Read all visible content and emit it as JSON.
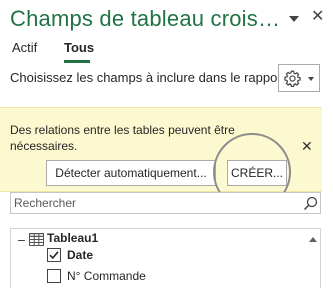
{
  "pane": {
    "title": "Champs de tableau crois…",
    "title_dropdown_icon": "chevron-down-icon",
    "close_icon": "close-icon"
  },
  "tabs": [
    {
      "label": "Actif",
      "active": false
    },
    {
      "label": "Tous",
      "active": true
    }
  ],
  "accent_color": "#217346",
  "choose_label": "Choisissez les champs à inclure dans le rapport :",
  "tools_button": {
    "icon": "gear-icon",
    "dropdown_icon": "chevron-down-icon"
  },
  "relations_notice": {
    "message": "Des relations entre les tables peuvent être nécessaires.",
    "background": "#fcf8cf",
    "detect_button": "Détecter automatiquement...",
    "create_button": "CRÉER...",
    "close_icon": "close-icon"
  },
  "search": {
    "placeholder": "Rechercher",
    "icon": "search-icon"
  },
  "field_list": {
    "table": {
      "name": "Tableau1",
      "expanded": true,
      "icon": "table-icon"
    },
    "fields": [
      {
        "label": "Date",
        "checked": true
      },
      {
        "label": "N° Commande",
        "checked": false
      }
    ]
  }
}
